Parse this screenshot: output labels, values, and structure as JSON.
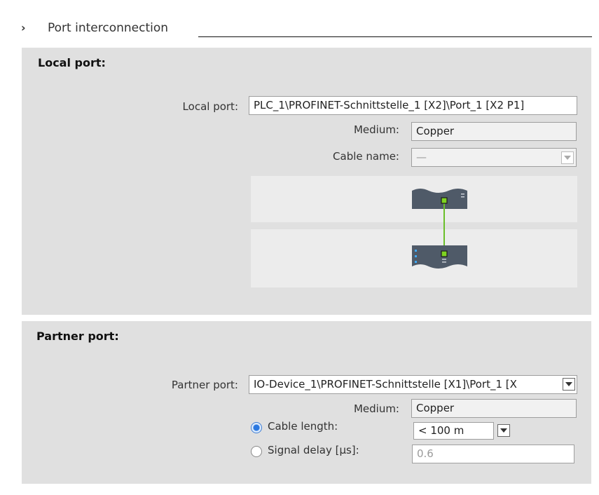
{
  "section": {
    "title": "Port interconnection"
  },
  "local": {
    "heading": "Local port:",
    "local_port_label": "Local port:",
    "local_port_value": "PLC_1\\PROFINET-Schnittstelle_1 [X2]\\Port_1 [X2 P1]",
    "medium_label": "Medium:",
    "medium_value": "Copper",
    "cable_name_label": "Cable name:",
    "cable_name_value": "—"
  },
  "partner": {
    "heading": "Partner port:",
    "partner_port_label": "Partner port:",
    "partner_port_value": "IO-Device_1\\PROFINET-Schnittstelle [X1]\\Port_1 [X",
    "medium_label": "Medium:",
    "medium_value": "Copper",
    "cable_length_label": "Cable length:",
    "cable_length_value": "< 100 m",
    "signal_delay_label": "Signal delay [µs]:",
    "signal_delay_value": "0.6",
    "selected_option": "cable_length"
  },
  "colors": {
    "panel": "#e0e0e0",
    "connector": "#6abf2a",
    "device": "#4f5a68",
    "radio": "#2b78e0"
  }
}
